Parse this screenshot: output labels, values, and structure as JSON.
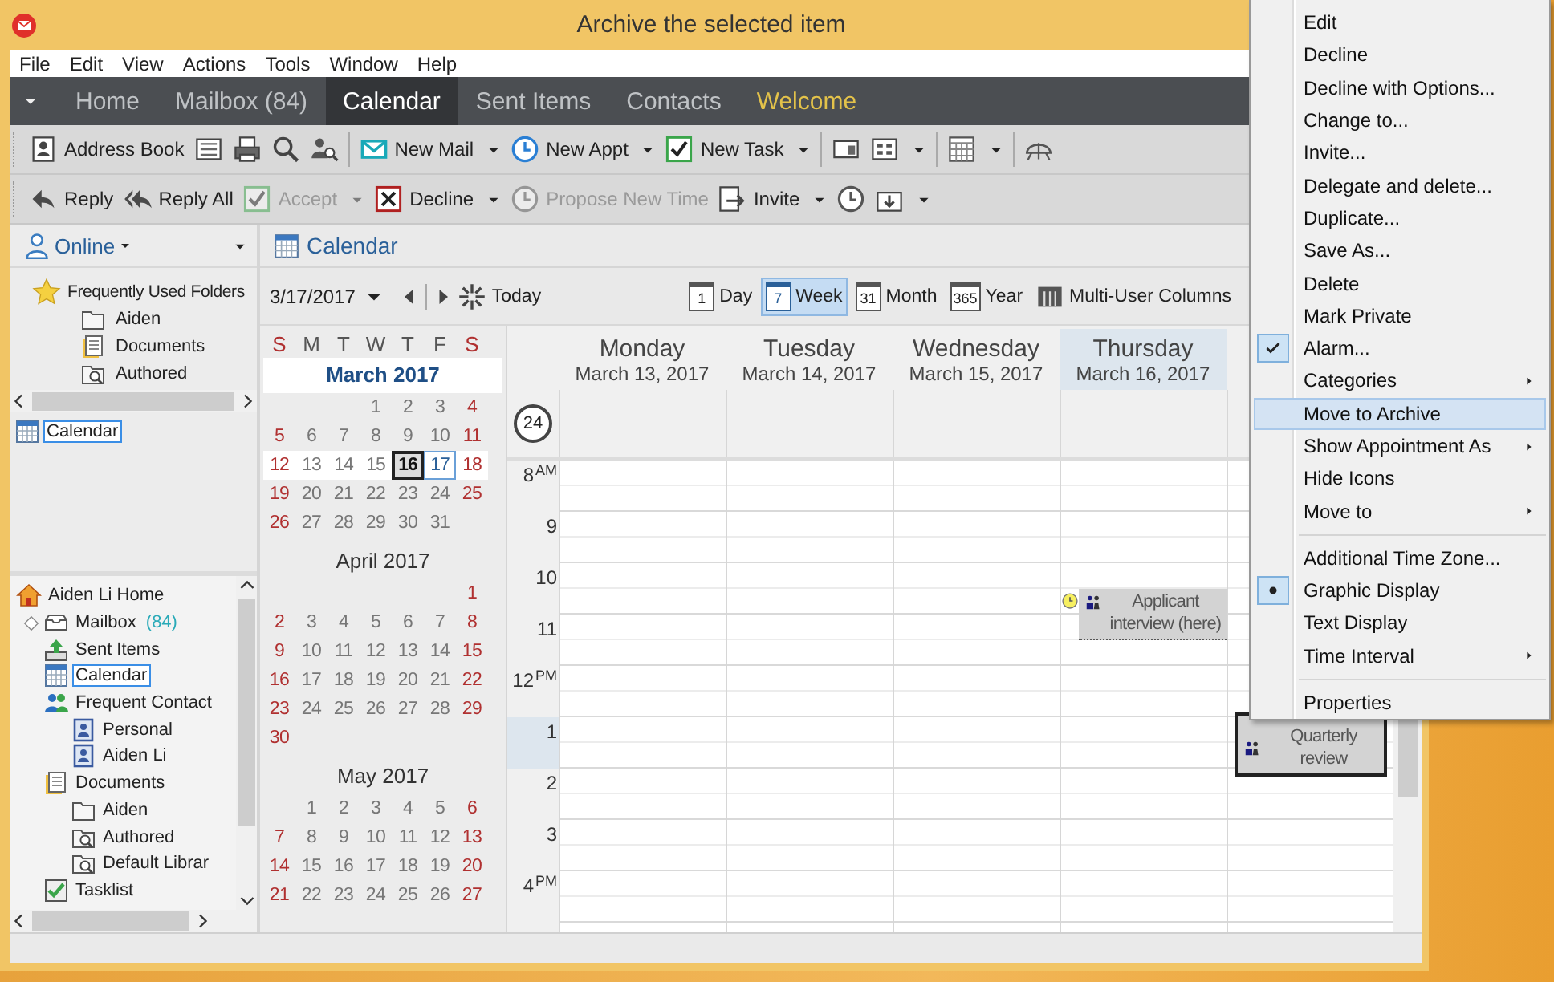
{
  "window": {
    "title": "Archive the selected item"
  },
  "menu_bar": [
    "File",
    "Edit",
    "View",
    "Actions",
    "Tools",
    "Window",
    "Help"
  ],
  "nav_tabs": [
    {
      "label": "Home",
      "selected": false,
      "highlighted": false
    },
    {
      "label": "Mailbox (84)",
      "selected": false,
      "highlighted": false
    },
    {
      "label": "Calendar",
      "selected": true,
      "highlighted": false
    },
    {
      "label": "Sent Items",
      "selected": false,
      "highlighted": false
    },
    {
      "label": "Contacts",
      "selected": false,
      "highlighted": false
    },
    {
      "label": "Welcome",
      "selected": false,
      "highlighted": true
    }
  ],
  "toolbar_1": [
    {
      "kind": "button",
      "label": "Address Book",
      "dropdown": false,
      "disabled": false
    },
    {
      "kind": "button",
      "dropdown": false,
      "disabled": false
    },
    {
      "kind": "button",
      "dropdown": false,
      "disabled": false
    },
    {
      "kind": "button",
      "dropdown": false,
      "disabled": false
    },
    {
      "kind": "button",
      "dropdown": false,
      "disabled": false
    },
    {
      "kind": "separator"
    },
    {
      "kind": "button",
      "label": "New Mail",
      "dropdown": true,
      "disabled": false
    },
    {
      "kind": "button",
      "label": "New Appt",
      "dropdown": true,
      "disabled": false
    },
    {
      "kind": "button",
      "label": "New Task",
      "dropdown": true,
      "disabled": false
    },
    {
      "kind": "separator"
    },
    {
      "kind": "button",
      "dropdown": false,
      "disabled": false
    },
    {
      "kind": "button",
      "dropdown": true,
      "disabled": false
    },
    {
      "kind": "separator"
    },
    {
      "kind": "button",
      "dropdown": true,
      "disabled": false
    },
    {
      "kind": "separator"
    },
    {
      "kind": "button",
      "dropdown": false,
      "disabled": false
    }
  ],
  "toolbar_2": [
    {
      "kind": "button",
      "label": "Reply",
      "dropdown": false,
      "disabled": false
    },
    {
      "kind": "button",
      "label": "Reply All",
      "dropdown": false,
      "disabled": false
    },
    {
      "kind": "button",
      "label": "Accept",
      "dropdown": true,
      "disabled": true
    },
    {
      "kind": "button",
      "label": "Decline",
      "dropdown": true,
      "disabled": false
    },
    {
      "kind": "button",
      "label": "Propose New Time",
      "dropdown": false,
      "disabled": true
    },
    {
      "kind": "button",
      "label": "Invite",
      "dropdown": true,
      "disabled": false
    },
    {
      "kind": "button",
      "dropdown": false,
      "disabled": false
    },
    {
      "kind": "button",
      "dropdown": true,
      "disabled": false
    }
  ],
  "left_pane": {
    "account": "Online",
    "favorites": {
      "label": "Frequently Used Folders",
      "kind": "star",
      "children": [
        {
          "label": "Aiden",
          "kind": "folder",
          "selected": false
        },
        {
          "label": "Documents",
          "kind": "documents",
          "selected": false
        },
        {
          "label": "Authored",
          "kind": "search-folder",
          "selected": false
        }
      ]
    },
    "current_folder": {
      "label": "Calendar",
      "kind": "calendar",
      "selected": true
    },
    "tree": [
      {
        "label": "Aiden Li Home",
        "kind": "home",
        "selected": false,
        "children": [
          {
            "label": "Mailbox",
            "count": "(84)",
            "kind": "mailbox",
            "selected": false,
            "collapsed": true
          },
          {
            "label": "Sent Items",
            "kind": "sent",
            "selected": false
          },
          {
            "label": "Calendar",
            "kind": "calendar",
            "selected": true
          },
          {
            "label": "Frequent Contact",
            "kind": "contacts",
            "selected": false,
            "children": [
              {
                "label": "Personal",
                "kind": "address-book",
                "selected": false
              },
              {
                "label": "Aiden Li",
                "kind": "address-book",
                "selected": false
              }
            ]
          },
          {
            "label": "Documents",
            "kind": "documents",
            "selected": false,
            "children": [
              {
                "label": "Aiden",
                "kind": "folder",
                "selected": false
              },
              {
                "label": "Authored",
                "kind": "search-folder",
                "selected": false
              },
              {
                "label": "Default Librar",
                "kind": "search-folder",
                "selected": false
              }
            ]
          },
          {
            "label": "Tasklist",
            "kind": "tasklist",
            "selected": false
          }
        ]
      }
    ]
  },
  "calendar": {
    "title": "Calendar",
    "date": "3/17/2017",
    "today": "Today",
    "views": [
      {
        "label": "Day",
        "badge": "1",
        "selected": false
      },
      {
        "label": "Week",
        "badge": "7",
        "selected": true
      },
      {
        "label": "Month",
        "badge": "31",
        "selected": false
      },
      {
        "label": "Year",
        "badge": "365",
        "selected": false
      },
      {
        "label": "Multi-User Columns",
        "selected": false
      }
    ]
  },
  "mini_calendar": {
    "weekdays": [
      "S",
      "M",
      "T",
      "W",
      "T",
      "F",
      "S"
    ],
    "months": [
      {
        "title": "March 2017",
        "highlighted": true,
        "weeks": [
          {
            "current": false,
            "days": [
              "1",
              "2",
              "3",
              "4"
            ]
          },
          {
            "current": false,
            "days": [
              "5",
              "6",
              "7",
              "8",
              "9",
              "10",
              "11"
            ]
          },
          {
            "current": true,
            "days": [
              {
                "label": "12",
                "today": false,
                "selected": false
              },
              {
                "label": "13",
                "today": false,
                "selected": false
              },
              {
                "label": "14",
                "today": false,
                "selected": false
              },
              {
                "label": "15",
                "today": false,
                "selected": false
              },
              {
                "label": "16",
                "today": true,
                "selected": false
              },
              {
                "label": "17",
                "today": false,
                "selected": true
              },
              {
                "label": "18",
                "today": false,
                "selected": false
              }
            ]
          },
          {
            "current": false,
            "days": [
              "19",
              "20",
              "21",
              "22",
              "23",
              "24",
              "25"
            ]
          },
          {
            "current": false,
            "days": [
              "26",
              "27",
              "28",
              "29",
              "30",
              "31"
            ]
          }
        ]
      },
      {
        "title": "April 2017",
        "highlighted": false,
        "weeks": [
          {
            "current": false,
            "days": [
              "1"
            ]
          },
          {
            "current": false,
            "days": [
              "2",
              "3",
              "4",
              "5",
              "6",
              "7",
              "8"
            ]
          },
          {
            "current": false,
            "days": [
              "9",
              "10",
              "11",
              "12",
              "13",
              "14",
              "15"
            ]
          },
          {
            "current": false,
            "days": [
              "16",
              "17",
              "18",
              "19",
              "20",
              "21",
              "22"
            ]
          },
          {
            "current": false,
            "days": [
              "23",
              "24",
              "25",
              "26",
              "27",
              "28",
              "29"
            ]
          },
          {
            "current": false,
            "days": [
              "30"
            ]
          }
        ]
      },
      {
        "title": "May 2017",
        "highlighted": false,
        "weeks": [
          {
            "current": false,
            "days": [
              "1",
              "2",
              "3",
              "4",
              "5",
              "6"
            ]
          },
          {
            "current": false,
            "days": [
              "7",
              "8",
              "9",
              "10",
              "11",
              "12",
              "13"
            ]
          },
          {
            "current": false,
            "days": [
              "14",
              "15",
              "16",
              "17",
              "18",
              "19",
              "20"
            ]
          },
          {
            "current": false,
            "days": [
              "21",
              "22",
              "23",
              "24",
              "25",
              "26",
              "27"
            ]
          }
        ]
      }
    ]
  },
  "week_view": {
    "zone_badge": "24",
    "hours": [
      {
        "label": "8",
        "suffix": "AM",
        "selected": false
      },
      {
        "label": "9",
        "selected": false
      },
      {
        "label": "10",
        "selected": false
      },
      {
        "label": "11",
        "selected": false
      },
      {
        "label": "12",
        "suffix": "PM",
        "selected": false
      },
      {
        "label": "1",
        "selected": true
      },
      {
        "label": "2",
        "selected": false
      },
      {
        "label": "3",
        "selected": false
      },
      {
        "label": "4",
        "suffix": "PM",
        "selected": false
      }
    ],
    "days": [
      {
        "name": "Monday",
        "date": "March 13, 2017",
        "selected": false
      },
      {
        "name": "Tuesday",
        "date": "March 14, 2017",
        "selected": false
      },
      {
        "name": "Wednesday",
        "date": "March 15, 2017",
        "selected": false
      },
      {
        "name": "Thursday",
        "date": "March 16, 2017",
        "selected": true,
        "appointments": [
          {
            "title": "Applicant interview (here)",
            "alarm": true,
            "selected": false
          }
        ]
      },
      {
        "appointments": [
          {
            "title": "Quarterly review",
            "alarm": false,
            "selected": true
          }
        ]
      }
    ]
  },
  "context_menu": [
    {
      "kind": "command",
      "label": "Edit",
      "checked": false,
      "selected": false,
      "submenu": false
    },
    {
      "kind": "command",
      "label": "Decline",
      "checked": false,
      "selected": false,
      "submenu": false
    },
    {
      "kind": "command",
      "label": "Decline with Options...",
      "checked": false,
      "selected": false,
      "submenu": false
    },
    {
      "kind": "command",
      "label": "Change to...",
      "checked": false,
      "selected": false,
      "submenu": false
    },
    {
      "kind": "command",
      "label": "Invite...",
      "checked": false,
      "selected": false,
      "submenu": false
    },
    {
      "kind": "command",
      "label": "Delegate and delete...",
      "checked": false,
      "selected": false,
      "submenu": false
    },
    {
      "kind": "command",
      "label": "Duplicate...",
      "checked": false,
      "selected": false,
      "submenu": false
    },
    {
      "kind": "command",
      "label": "Save As...",
      "checked": false,
      "selected": false,
      "submenu": false
    },
    {
      "kind": "command",
      "label": "Delete",
      "checked": false,
      "selected": false,
      "submenu": false
    },
    {
      "kind": "command",
      "label": "Mark Private",
      "checked": false,
      "selected": false,
      "submenu": false
    },
    {
      "kind": "check",
      "label": "Alarm...",
      "checked": true,
      "selected": false,
      "submenu": false
    },
    {
      "kind": "command",
      "label": "Categories",
      "checked": false,
      "selected": false,
      "submenu": true
    },
    {
      "kind": "command",
      "label": "Move to Archive",
      "checked": false,
      "selected": true,
      "submenu": false
    },
    {
      "kind": "command",
      "label": "Show Appointment As",
      "checked": false,
      "selected": false,
      "submenu": true
    },
    {
      "kind": "command",
      "label": "Hide Icons",
      "checked": false,
      "selected": false,
      "submenu": false
    },
    {
      "kind": "command",
      "label": "Move to",
      "checked": false,
      "selected": false,
      "submenu": true
    },
    {
      "kind": "separator"
    },
    {
      "kind": "command",
      "label": "Additional Time Zone...",
      "checked": false,
      "selected": false,
      "submenu": false
    },
    {
      "kind": "radio",
      "label": "Graphic Display",
      "checked": true,
      "selected": false,
      "submenu": false
    },
    {
      "kind": "radio",
      "label": "Text Display",
      "checked": false,
      "selected": false,
      "submenu": false
    },
    {
      "kind": "command",
      "label": "Time Interval",
      "checked": false,
      "selected": false,
      "submenu": true
    },
    {
      "kind": "separator"
    },
    {
      "kind": "command",
      "label": "Properties",
      "checked": false,
      "selected": false,
      "submenu": false
    }
  ]
}
